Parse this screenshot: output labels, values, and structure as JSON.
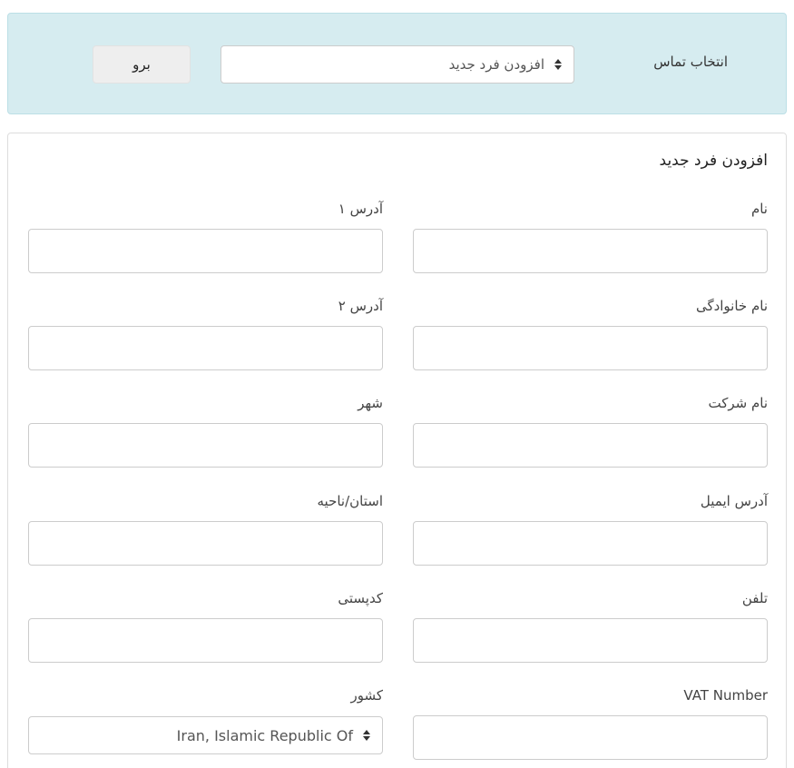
{
  "contact_bar": {
    "label": "انتخاب تماس",
    "selected": "افزودن فرد جدید",
    "go_label": "برو"
  },
  "form": {
    "title": "افزودن فرد جدید",
    "fields": {
      "first_name": "نام",
      "last_name": "نام خانوادگی",
      "company": "نام شرکت",
      "email": "آدرس ایمیل",
      "phone": "تلفن",
      "vat": "VAT Number",
      "address1": "آدرس ۱",
      "address2": "آدرس ۲",
      "city": "شهر",
      "state": "استان/ناحیه",
      "postcode": "کدپستی",
      "country": "کشور"
    },
    "country_selected": "Iran, Islamic Republic Of"
  },
  "colors": {
    "panel_bg": "#d6ecf0",
    "button_bg": "#eeeeee",
    "border": "#cccccc"
  }
}
